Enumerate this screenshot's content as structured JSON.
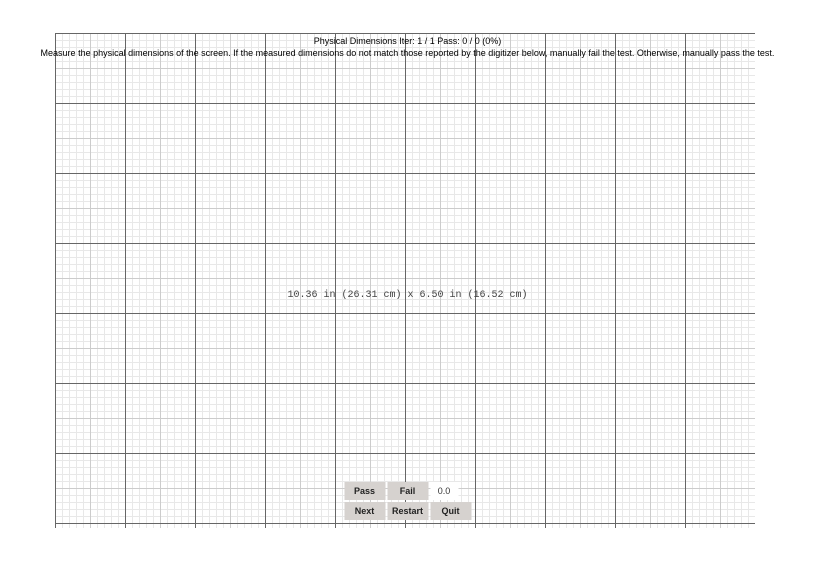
{
  "header": {
    "title_line": "Physical Dimensions   Iter: 1 / 1   Pass: 0 / 0 (0%)",
    "instruction": "Measure the physical dimensions of the screen. If the measured dimensions do not match those reported by the digitizer below, manually fail the test. Otherwise, manually pass the test."
  },
  "center": {
    "measurement": "10.36 in (26.31 cm) x 6.50 in (16.52 cm)"
  },
  "buttons": {
    "pass": "Pass",
    "fail": "Fail",
    "counter": "0.0",
    "next": "Next",
    "restart": "Restart",
    "quit": "Quit"
  }
}
